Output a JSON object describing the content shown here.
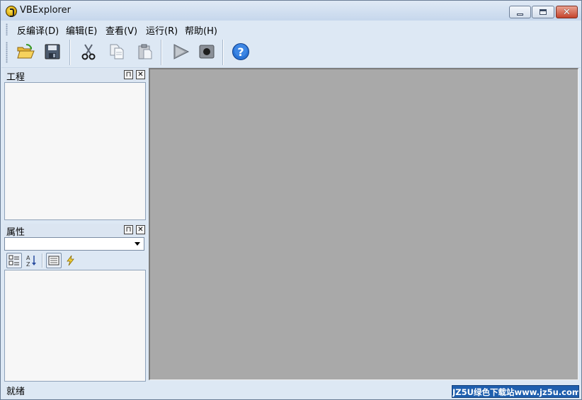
{
  "window": {
    "title": "VBExplorer"
  },
  "menu": {
    "items": [
      {
        "label": "反编译(D)"
      },
      {
        "label": "编辑(E)"
      },
      {
        "label": "查看(V)"
      },
      {
        "label": "运行(R)"
      },
      {
        "label": "帮助(H)"
      }
    ]
  },
  "toolbar": {
    "icons": [
      "open-folder-icon",
      "save-icon",
      "cut-icon",
      "copy-icon",
      "paste-icon",
      "run-icon",
      "stop-icon",
      "help-icon"
    ]
  },
  "project_panel": {
    "title": "工程"
  },
  "properties_panel": {
    "title": "属性",
    "selected_object": ""
  },
  "status": {
    "text": "就绪"
  },
  "watermark": {
    "text": "JZ5U绿色下载站www.jz5u.com"
  },
  "colors": {
    "workspace": "#a9a9a9",
    "chrome": "#dde8f4",
    "close_button": "#c5432b"
  }
}
